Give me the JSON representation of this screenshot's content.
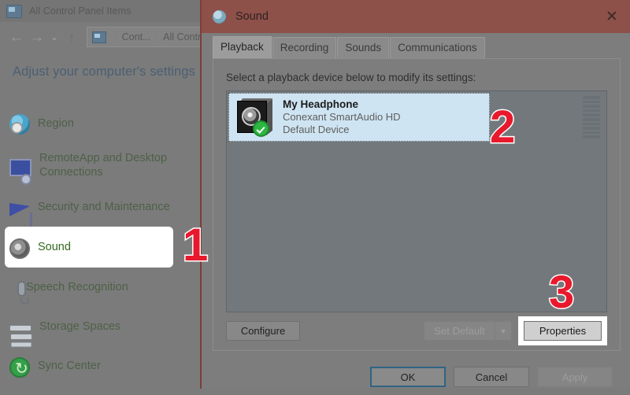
{
  "control_panel": {
    "title": "All Control Panel Items",
    "title_icon": "control-panel-icon",
    "minimize_label": "—",
    "nav": {
      "back": "←",
      "forward": "→",
      "recent": "⌄",
      "up": "↑"
    },
    "breadcrumb": {
      "icon": "control-panel-icon",
      "items": [
        "Cont...",
        "All Contr"
      ],
      "separator": "›"
    },
    "heading": "Adjust your computer's settings",
    "items": [
      {
        "label": "Region",
        "icon": "region-icon",
        "selected": false
      },
      {
        "label": "RemoteApp and Desktop Connections",
        "icon": "remoteapp-icon",
        "selected": false
      },
      {
        "label": "Security and Maintenance",
        "icon": "flag-icon",
        "selected": false
      },
      {
        "label": "Sound",
        "icon": "speaker-icon",
        "selected": true
      },
      {
        "label": "Speech Recognition",
        "icon": "microphone-icon",
        "selected": false
      },
      {
        "label": "Storage Spaces",
        "icon": "storage-icon",
        "selected": false
      },
      {
        "label": "Sync Center",
        "icon": "sync-icon",
        "selected": false
      }
    ]
  },
  "sound_dialog": {
    "title": "Sound",
    "title_icon": "sound-icon",
    "close_label": "✕",
    "tabs": [
      {
        "label": "Playback",
        "active": true
      },
      {
        "label": "Recording",
        "active": false
      },
      {
        "label": "Sounds",
        "active": false
      },
      {
        "label": "Communications",
        "active": false
      }
    ],
    "prompt": "Select a playback device below to modify its settings:",
    "devices": [
      {
        "name": "My Headphone",
        "description": "Conexant SmartAudio HD",
        "status": "Default Device",
        "icon": "speaker-icon",
        "badge": "default-check-icon",
        "selected": true,
        "meter_segments": 10
      }
    ],
    "buttons": {
      "configure": "Configure",
      "set_default": "Set Default",
      "set_default_arrow": "▼",
      "properties": "Properties",
      "ok": "OK",
      "cancel": "Cancel",
      "apply": "Apply"
    },
    "disabled_buttons": [
      "Set Default",
      "Apply"
    ]
  },
  "annotations": [
    {
      "label": "1",
      "target": "sidebar-item-sound"
    },
    {
      "label": "2",
      "target": "device-list-item"
    },
    {
      "label": "3",
      "target": "properties-button"
    }
  ],
  "colors": {
    "annotation_red": "#e8192c",
    "dialog_titlebar": "#8d514a",
    "selection_blue": "#cfe4f2",
    "focus_border": "#2f6484",
    "sidebar_link": "#4d6147",
    "heading": "#4a5f73"
  }
}
